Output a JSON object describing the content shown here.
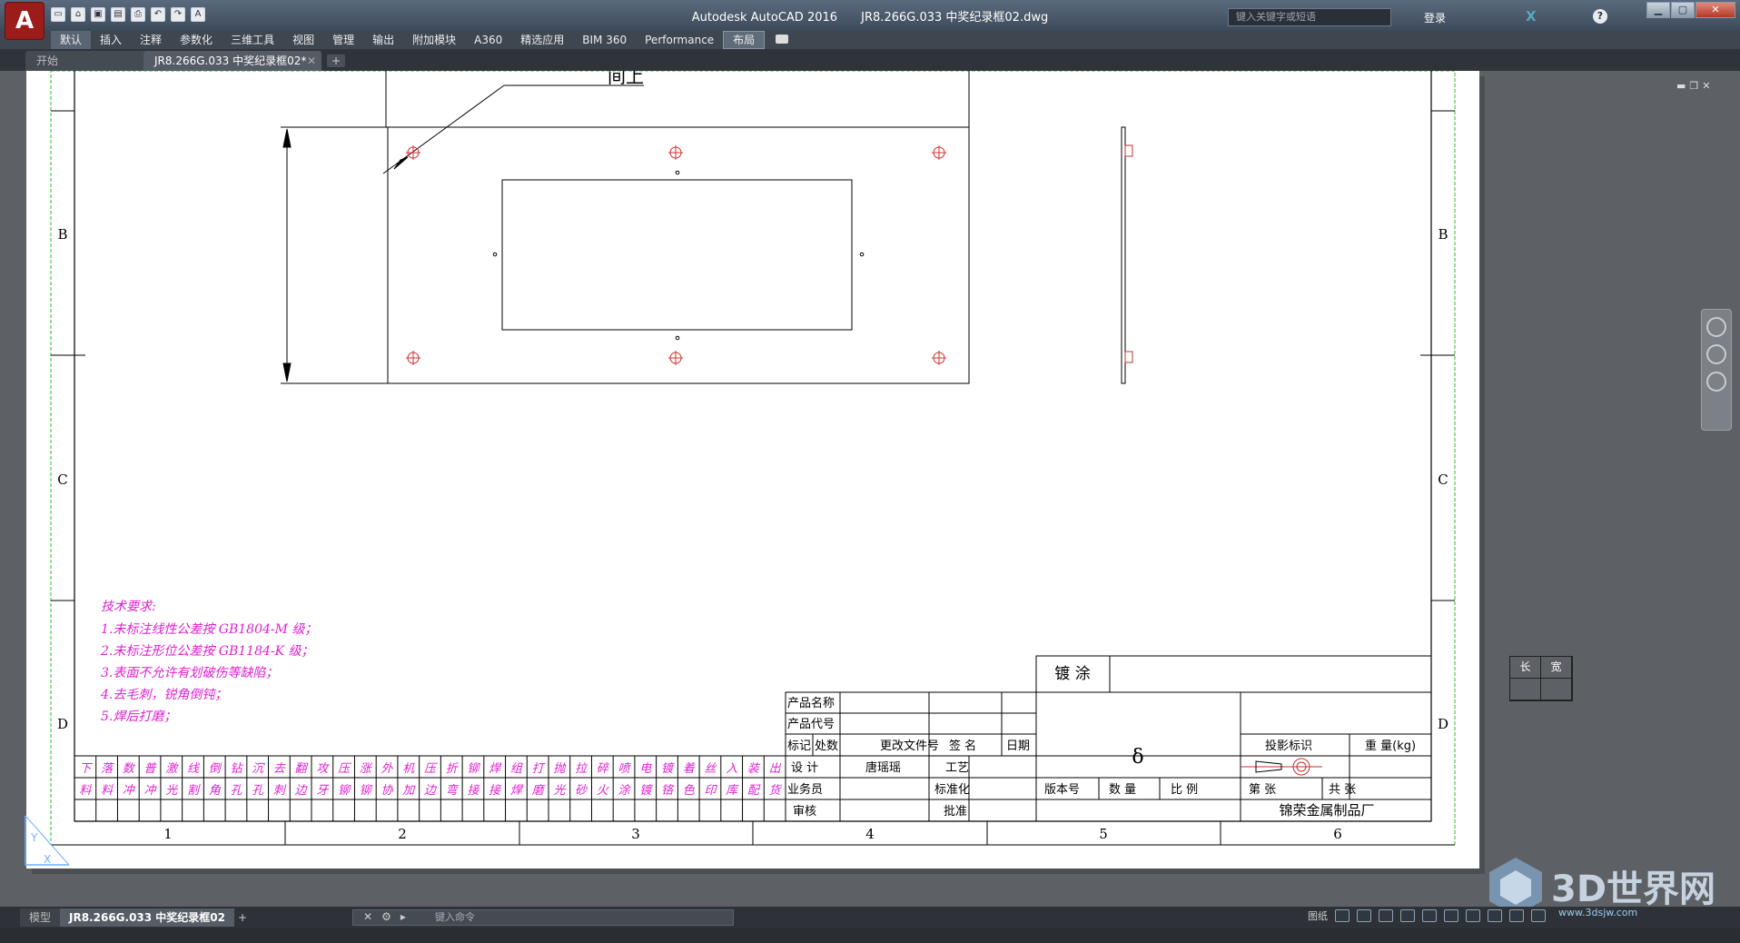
{
  "window": {
    "app_title": "Autodesk AutoCAD 2016",
    "doc_title": "JR8.266G.033 中奖纪录框02.dwg",
    "search_placeholder": "键入关键字或短语",
    "login": "登录"
  },
  "ribbon": {
    "tabs": [
      "默认",
      "插入",
      "注释",
      "参数化",
      "三维工具",
      "视图",
      "管理",
      "输出",
      "附加模块",
      "A360",
      "精选应用",
      "BIM 360",
      "Performance",
      "布局"
    ]
  },
  "file_tabs": {
    "start": "开始",
    "doc": "JR8.266G.033 中奖纪录框02*"
  },
  "drawing": {
    "zone_letters": [
      "B",
      "C",
      "D"
    ],
    "zone_numbers": [
      "1",
      "2",
      "3",
      "4",
      "5",
      "6"
    ],
    "leader_text": "间上",
    "tech_notes": [
      "技术要求:",
      "1.未标注线性公差按 GB1804-M 级；",
      "2.未标注形位公差按 GB1184-K 级；",
      "3.表面不允许有划破伤等缺陷；",
      "4.去毛刺，锐角倒钝；",
      "5.焊后打磨；"
    ],
    "process_row1": [
      "下",
      "落",
      "数",
      "普",
      "激",
      "线",
      "倒",
      "钻",
      "沉",
      "去",
      "翻",
      "攻",
      "压",
      "涨",
      "外",
      "机",
      "压",
      "折",
      "铆",
      "焊",
      "组",
      "打",
      "抛",
      "拉",
      "碎",
      "喷",
      "电",
      "镀",
      "着",
      "丝",
      "入",
      "装",
      "出"
    ],
    "process_row2": [
      "料",
      "料",
      "冲",
      "冲",
      "光",
      "割",
      "角",
      "孔",
      "孔",
      "刺",
      "边",
      "牙",
      "铆",
      "铆",
      "协",
      "加",
      "边",
      "弯",
      "接",
      "接",
      "焊",
      "磨",
      "光",
      "砂",
      "火",
      "涂",
      "镀",
      "铬",
      "色",
      "印",
      "库",
      "配",
      "货"
    ],
    "title_block": {
      "plating": "镀  涂",
      "product_name": "产品名称",
      "product_code": "产品代号",
      "mark": "标记",
      "count": "处数",
      "change_doc": "更改文件号",
      "signature": "签  名",
      "date": "日期",
      "design": "设  计",
      "designer": "唐瑶瑶",
      "process": "工艺",
      "salesman": "业务员",
      "standard": "标准化",
      "review": "审核",
      "approve": "批准",
      "thickness": "δ",
      "projection": "投影标识",
      "weight": "重    量(kg)",
      "version": "版本号",
      "quantity": "数  量",
      "scale": "比  例",
      "sheet_no": "第        张",
      "sheet_total": "共        张",
      "company": "锦荣金属制品厂"
    }
  },
  "side_table": [
    "长",
    "宽"
  ],
  "layout_tabs": {
    "model": "模型",
    "layout": "JR8.266G.033 中奖纪录框02",
    "add": "+"
  },
  "command": {
    "placeholder": "键入命令"
  },
  "status": {
    "paper": "图纸"
  },
  "watermark": {
    "brand": "3D世界网",
    "url": "www.3dsjw.com"
  },
  "colors": {
    "accent_magenta": "#e020d0",
    "drawing_line": "#000000",
    "center_mark": "#d03030",
    "green_border": "#2bbf2b"
  }
}
